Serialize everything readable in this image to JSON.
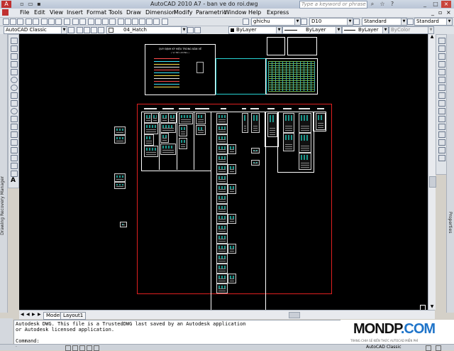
{
  "window": {
    "title": "AutoCAD 2010     A7 - ban ve do roi.dwg",
    "search_placeholder": "Type a keyword or phrase"
  },
  "menu": [
    "File",
    "Edit",
    "View",
    "Insert",
    "Format",
    "Tools",
    "Draw",
    "Dimension",
    "Modify",
    "Parametric",
    "Window",
    "Help",
    "Express"
  ],
  "toolbar": {
    "layer": "ghichu",
    "text_style": "Standard",
    "dim_style": "Standard",
    "scale": "D10",
    "workspace": "AutoCAD Classic",
    "current_layer": "04_Hatch",
    "color": "ByLayer",
    "linetype": "ByLayer",
    "lineweight": "ByLayer",
    "plotstyle": "ByColor"
  },
  "left_palette_label": "Drawing Recovery Manager",
  "right_palette_label": "Properties",
  "drawing": {
    "note_title": "QUY ĐỊNH KÝ HIỆU TRONG BẢN VẼ",
    "note_sub": "( VỊ TRÍ LƯƠNG )"
  },
  "layout_tabs": [
    "Model",
    "Layout1"
  ],
  "command": {
    "line1": "Autodesk DWG.  This file is a TrustedDWG last saved by an Autodesk application",
    "line2": "or Autodesk licensed application.",
    "prompt": "Command:"
  },
  "logo": {
    "text_left": "MONDP",
    "text_right": ".COM",
    "tagline": "TRANG CHIA SẺ KIẾN THỨC AUTOCAD MIỄN PHÍ",
    "color_dark": "#111111",
    "color_accent": "#1f74c9"
  },
  "status": {
    "workspace": "AutoCAD Classic"
  }
}
